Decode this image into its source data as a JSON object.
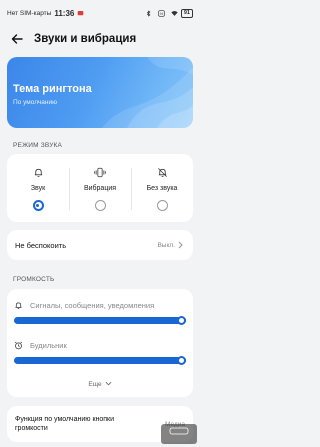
{
  "status_bar": {
    "carrier": "Нет SIM-карты",
    "time": "11:36",
    "battery": "91"
  },
  "header": {
    "title": "Звуки и вибрация"
  },
  "banner": {
    "title": "Тема рингтона",
    "subtitle": "По умолчанию"
  },
  "sound_mode": {
    "section_label": "РЕЖИМ ЗВУКА",
    "options": [
      {
        "label": "Звук",
        "icon": "bell-icon",
        "selected": true
      },
      {
        "label": "Вибрация",
        "icon": "vibrate-icon",
        "selected": false
      },
      {
        "label": "Без звука",
        "icon": "bell-off-icon",
        "selected": false
      }
    ]
  },
  "do_not_disturb": {
    "label": "Не беспокоить",
    "value": "Выкл."
  },
  "volume": {
    "section_label": "ГРОМКОСТЬ",
    "sliders": [
      {
        "label": "Сигналы, сообщения, уведомления",
        "icon": "bell-icon",
        "level": 1.0
      },
      {
        "label": "Будильник",
        "icon": "alarm-clock-icon",
        "level": 1.0
      }
    ],
    "more_label": "Еще"
  },
  "volume_buttons": {
    "label": "Функция по умолчанию кнопки громкости",
    "value": "Медиа"
  },
  "colors": {
    "accent": "#1967d2",
    "background": "#f1f3f5",
    "card": "#ffffff"
  }
}
